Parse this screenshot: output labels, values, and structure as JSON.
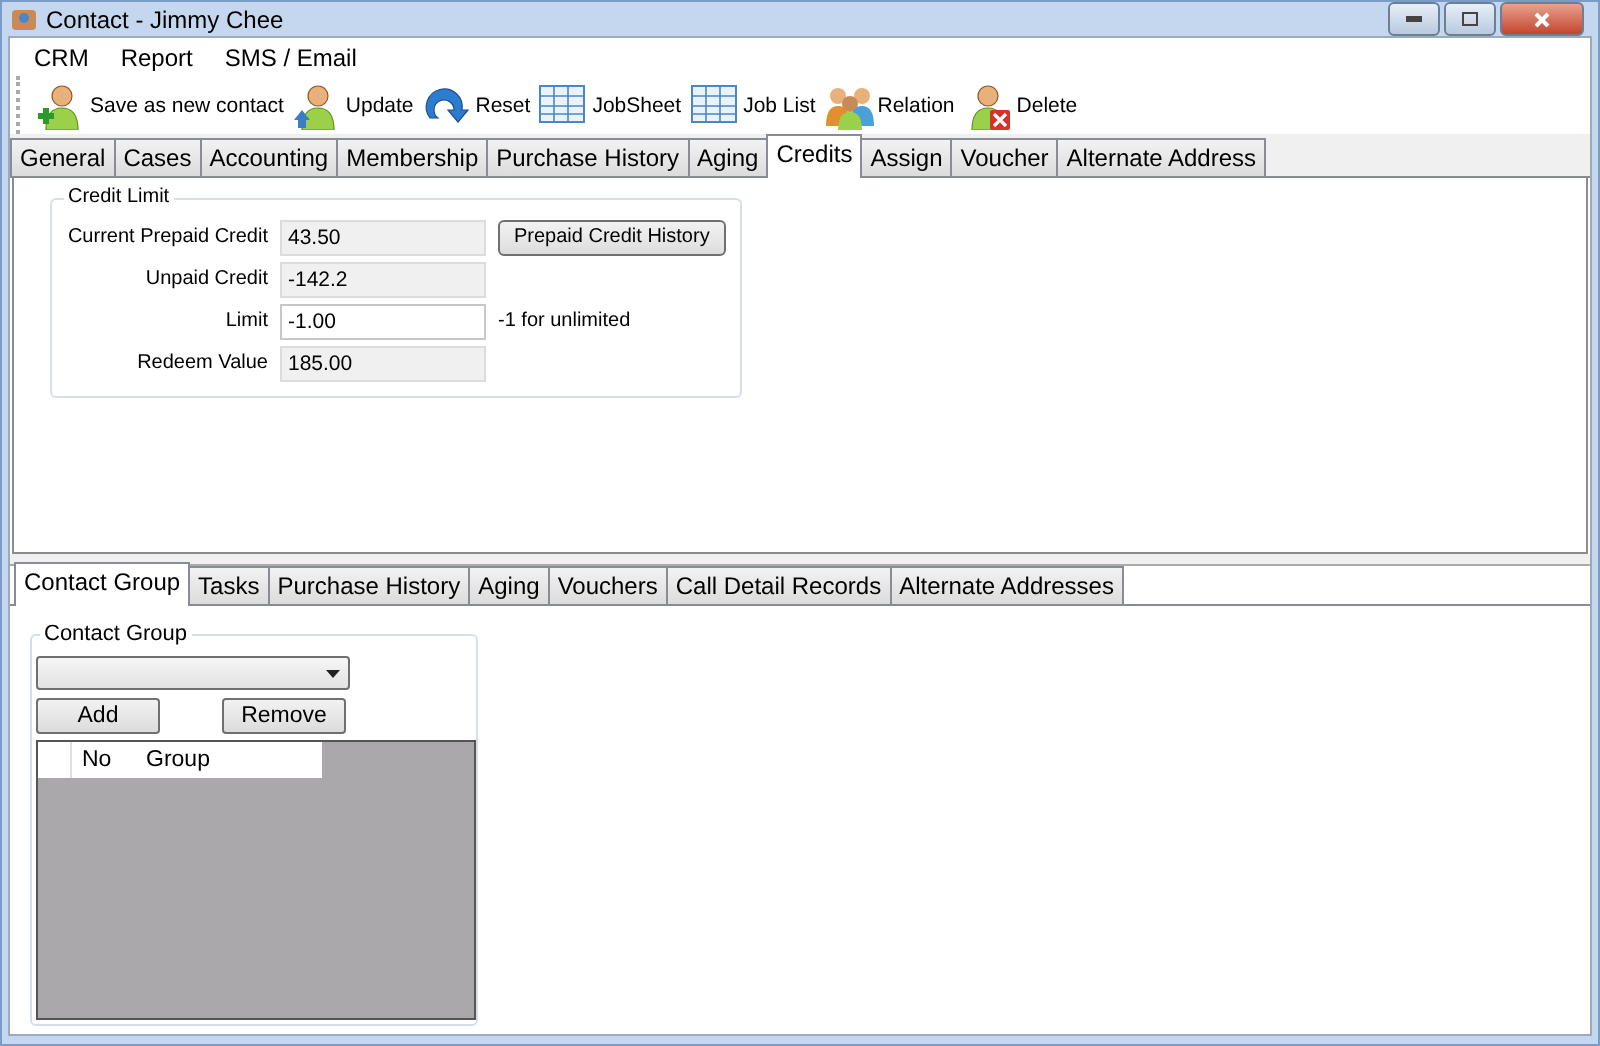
{
  "window": {
    "title": "Contact - Jimmy Chee"
  },
  "menu": [
    "CRM",
    "Report",
    "SMS / Email"
  ],
  "toolbar": [
    {
      "label": "Save as new contact",
      "kind": "add"
    },
    {
      "label": "Update",
      "kind": "update"
    },
    {
      "label": "Reset",
      "kind": "reset"
    },
    {
      "label": "JobSheet",
      "kind": "grid"
    },
    {
      "label": "Job List",
      "kind": "grid"
    },
    {
      "label": "Relation",
      "kind": "group"
    },
    {
      "label": "Delete",
      "kind": "delete"
    }
  ],
  "tabs": [
    {
      "label": "General",
      "selected": false
    },
    {
      "label": "Cases",
      "selected": false
    },
    {
      "label": "Accounting",
      "selected": false
    },
    {
      "label": "Membership",
      "selected": false
    },
    {
      "label": "Purchase History",
      "selected": false
    },
    {
      "label": "Aging",
      "selected": false
    },
    {
      "label": "Credits",
      "selected": true
    },
    {
      "label": "Assign",
      "selected": false
    },
    {
      "label": "Voucher",
      "selected": false
    },
    {
      "label": "Alternate Address",
      "selected": false
    }
  ],
  "credit_limit": {
    "title": "Credit Limit",
    "fields": [
      {
        "label": "Current Prepaid Credit",
        "value": "43.50",
        "readonly": true,
        "button": "Prepaid Credit History"
      },
      {
        "label": "Unpaid Credit",
        "value": "-142.2",
        "readonly": true
      },
      {
        "label": "Limit",
        "value": "-1.00",
        "readonly": false,
        "note": "-1 for unlimited"
      },
      {
        "label": "Redeem Value",
        "value": "185.00",
        "readonly": true
      }
    ]
  },
  "bottom_tabs": [
    {
      "label": "Contact Group",
      "selected": true
    },
    {
      "label": "Tasks",
      "selected": false
    },
    {
      "label": "Purchase History",
      "selected": false
    },
    {
      "label": "Aging",
      "selected": false
    },
    {
      "label": "Vouchers",
      "selected": false
    },
    {
      "label": "Call Detail Records",
      "selected": false
    },
    {
      "label": "Alternate Addresses",
      "selected": false
    }
  ],
  "contact_group": {
    "title": "Contact Group",
    "buttons": [
      "Add",
      "Remove"
    ],
    "columns": [
      "No",
      "Group"
    ]
  }
}
